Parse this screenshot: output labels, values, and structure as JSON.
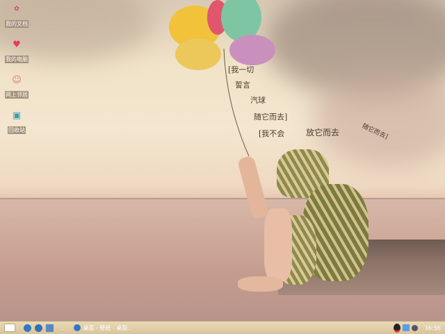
{
  "desktop": {
    "icons": [
      {
        "label": "我的文档",
        "icon": "my-documents-icon"
      },
      {
        "label": "我的电脑",
        "icon": "heart-computer-icon"
      },
      {
        "label": "网上邻居",
        "icon": "network-icon"
      },
      {
        "label": "回收站",
        "icon": "recycle-bin-icon"
      }
    ],
    "wallpaper_text": [
      "[我一切",
      "誓言",
      "汽球",
      "随它而去]",
      "[我不会",
      "放它而去",
      "随它而去]"
    ]
  },
  "taskbar": {
    "start_icon": "start-icon",
    "quicklaunch": [
      "ie-icon",
      "media-icon",
      "desktop-icon"
    ],
    "task_label": "桌面 - 壁纸 - 桌面...",
    "tray": [
      "qq-icon",
      "network-tray-icon",
      "volume-icon"
    ],
    "clock": "16:56"
  }
}
